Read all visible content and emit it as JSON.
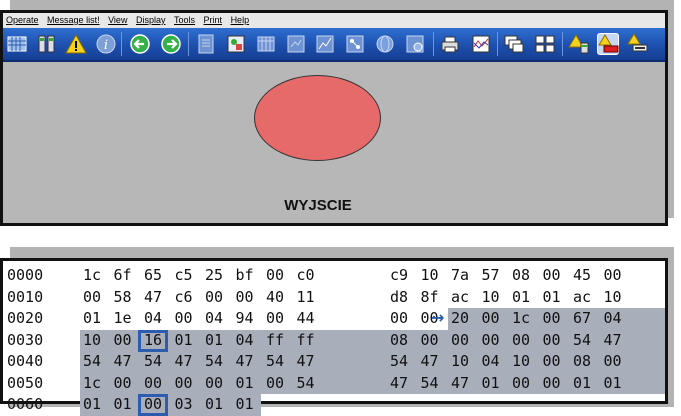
{
  "menu": [
    "Operate",
    "Message list!",
    "View",
    "Display",
    "Tools",
    "Print",
    "Help"
  ],
  "toolbar_icons": [
    "grid-icon",
    "tower-icon",
    "warning-icon",
    "info-icon",
    "back-icon",
    "forward-icon",
    "page-icon",
    "image-icon",
    "table-icon",
    "panel-icon",
    "chart-icon",
    "network-icon",
    "globe-icon",
    "camera-icon",
    "printer-icon",
    "graph-icon",
    "windows-icon",
    "tile-icon",
    "alarm-device-icon",
    "alarm-red-icon",
    "alarm-list-icon"
  ],
  "lamp": {
    "label": "WYJSCIE",
    "color": "#e66a69"
  },
  "hex": {
    "rows": [
      {
        "offset": "0000",
        "bytes": [
          "1c",
          "6f",
          "65",
          "c5",
          "25",
          "bf",
          "00",
          "c0",
          "c9",
          "10",
          "7a",
          "57",
          "08",
          "00",
          "45",
          "00"
        ]
      },
      {
        "offset": "0010",
        "bytes": [
          "00",
          "58",
          "47",
          "c6",
          "00",
          "00",
          "40",
          "11",
          "d8",
          "8f",
          "ac",
          "10",
          "01",
          "01",
          "ac",
          "10"
        ]
      },
      {
        "offset": "0020",
        "bytes": [
          "01",
          "1e",
          "04",
          "00",
          "04",
          "94",
          "00",
          "44",
          "00",
          "00",
          "20",
          "00",
          "1c",
          "00",
          "67",
          "04"
        ]
      },
      {
        "offset": "0030",
        "bytes": [
          "10",
          "00",
          "16",
          "01",
          "01",
          "04",
          "ff",
          "ff",
          "08",
          "00",
          "00",
          "00",
          "00",
          "00",
          "54",
          "47"
        ]
      },
      {
        "offset": "0040",
        "bytes": [
          "54",
          "47",
          "54",
          "47",
          "54",
          "47",
          "54",
          "47",
          "54",
          "47",
          "10",
          "04",
          "10",
          "00",
          "08",
          "00"
        ]
      },
      {
        "offset": "0050",
        "bytes": [
          "1c",
          "00",
          "00",
          "00",
          "00",
          "01",
          "00",
          "54",
          "47",
          "54",
          "47",
          "01",
          "00",
          "00",
          "01",
          "01"
        ]
      },
      {
        "offset": "0060",
        "bytes": [
          "01",
          "01",
          "00",
          "03",
          "01",
          "01"
        ]
      }
    ],
    "selection_start": {
      "row": 2,
      "col": 10
    },
    "boxed": [
      {
        "row": 3,
        "col": 2
      },
      {
        "row": 6,
        "col": 2
      }
    ]
  }
}
